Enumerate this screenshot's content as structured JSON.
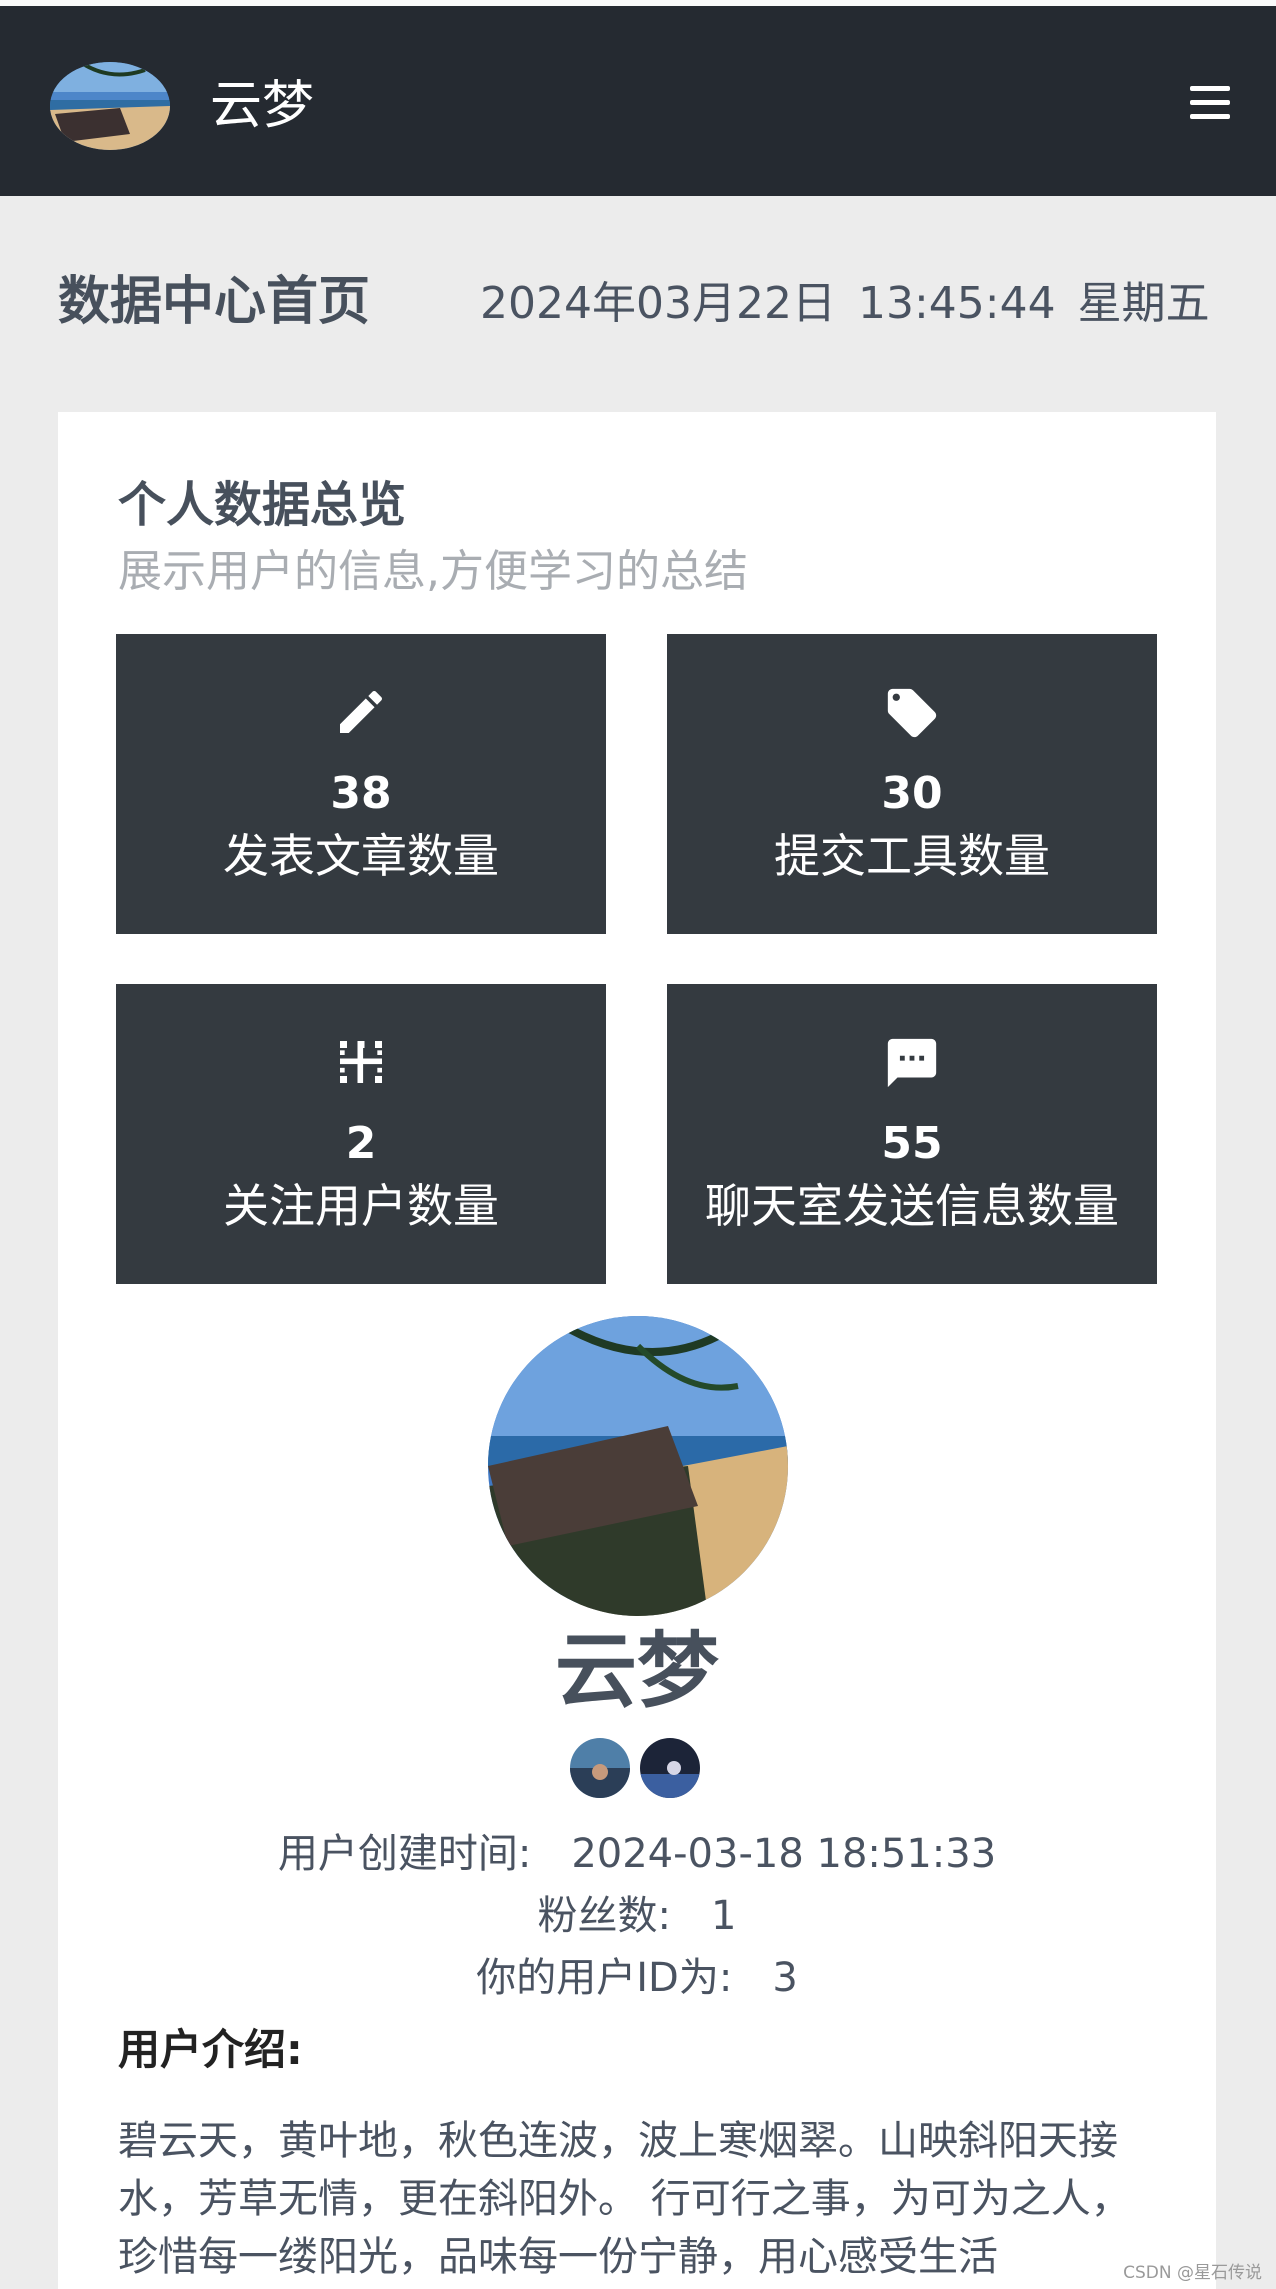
{
  "navbar": {
    "title": "云梦",
    "avatar_icon": "beach-avatar-icon",
    "menu_icon": "hamburger-menu-icon"
  },
  "page": {
    "title": "数据中心首页",
    "date": "2024年03月22日",
    "time": "13:45:44",
    "weekday": "星期五"
  },
  "overview": {
    "title": "个人数据总览",
    "subtitle": "展示用户的信息,方便学习的总结",
    "tiles": [
      {
        "icon": "pencil-icon",
        "value": "38",
        "label": "发表文章数量"
      },
      {
        "icon": "tag-icon",
        "value": "30",
        "label": "提交工具数量"
      },
      {
        "icon": "grid-icon",
        "value": "2",
        "label": "关注用户数量"
      },
      {
        "icon": "chat-icon",
        "value": "55",
        "label": "聊天室发送信息数量"
      }
    ]
  },
  "profile": {
    "name": "云梦",
    "created_label": "用户创建时间:",
    "created_value": "2024-03-18 18:51:33",
    "fans_label": "粉丝数:",
    "fans_value": "1",
    "id_label": "你的用户ID为:",
    "id_value": "3",
    "intro_title": "用户介绍:",
    "intro_text": "碧云天，黄叶地，秋色连波，波上寒烟翠。山映斜阳天接水，芳草无情，更在斜阳外。 行可行之事，为可为之人，珍惜每一缕阳光，品味每一份宁静，用心感受生活"
  },
  "watermark": "CSDN @星石传说",
  "colors": {
    "navbar": "#252a31",
    "tile": "#343a40",
    "page_bg": "#ececec",
    "heading": "#47505c"
  }
}
